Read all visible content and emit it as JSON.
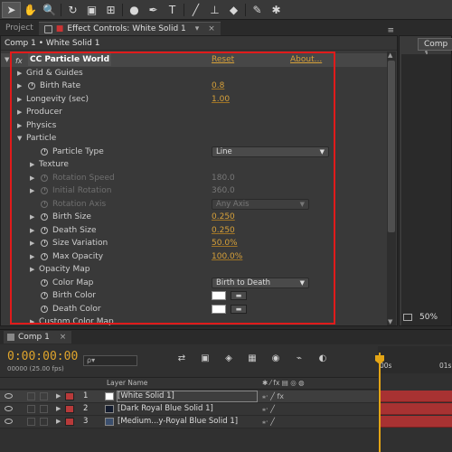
{
  "panel_tabs": {
    "project": "Project",
    "effect_controls": "Effect Controls: White Solid 1",
    "comp_tab": "Comp 1"
  },
  "breadcrumb": "Comp 1 • White Solid 1",
  "effect": {
    "name": "CC Particle World",
    "reset": "Reset",
    "about": "About..."
  },
  "properties": [
    {
      "label": "Grid & Guides"
    },
    {
      "label": "Birth Rate",
      "value": "0.8"
    },
    {
      "label": "Longevity (sec)",
      "value": "1.00"
    },
    {
      "label": "Producer"
    },
    {
      "label": "Physics"
    },
    {
      "label": "Particle"
    },
    {
      "label": "Particle Type",
      "value": "Line"
    },
    {
      "label": "Texture"
    },
    {
      "label": "Rotation Speed",
      "value": "180.0"
    },
    {
      "label": "Initial Rotation",
      "value": "360.0"
    },
    {
      "label": "Rotation Axis",
      "value": "Any Axis"
    },
    {
      "label": "Birth Size",
      "value": "0.250"
    },
    {
      "label": "Death Size",
      "value": "0.250"
    },
    {
      "label": "Size Variation",
      "value": "50.0%"
    },
    {
      "label": "Max Opacity",
      "value": "100.0%"
    },
    {
      "label": "Opacity Map"
    },
    {
      "label": "Color Map",
      "value": "Birth to Death"
    },
    {
      "label": "Birth Color"
    },
    {
      "label": "Death Color"
    },
    {
      "label": "Custom Color Map"
    }
  ],
  "right_panel": {
    "zoom": "50%"
  },
  "timeline": {
    "tab": "Comp 1",
    "timecode": "0:00:00:00",
    "timecode_sub": "00000 (25.00 fps)",
    "search_placeholder": "ρ▾",
    "layer_name_header": "Layer Name",
    "ruler_labels": [
      "00s",
      "01s"
    ],
    "layers": [
      {
        "num": "1",
        "name": "[White Solid 1]",
        "swatch": "#ffffff",
        "label_color": "#b83a3a"
      },
      {
        "num": "2",
        "name": "[Dark Royal Blue Solid 1]",
        "swatch": "#141c2e",
        "label_color": "#b83a3a"
      },
      {
        "num": "3",
        "name": "[Medium...y-Royal Blue Solid 1]",
        "swatch": "#3b4f6e",
        "label_color": "#b83a3a"
      }
    ]
  },
  "colors": {
    "accent_value": "#d7a13a",
    "highlight_box": "#e01b1b",
    "layer_bar": "#a83232",
    "playhead": "#e3a516"
  },
  "icons": [
    "selection-tool-icon",
    "hand-tool-icon",
    "zoom-tool-icon",
    "rotate-tool-icon",
    "camera-tool-icon",
    "pan-behind-icon",
    "mask-tool-icon",
    "pen-tool-icon",
    "type-tool-icon",
    "brush-tool-icon",
    "clone-stamp-icon",
    "eraser-icon",
    "roto-brush-icon",
    "puppet-pin-icon",
    "stopwatch-icon",
    "eyedropper-icon",
    "eye-icon",
    "lock-icon"
  ]
}
